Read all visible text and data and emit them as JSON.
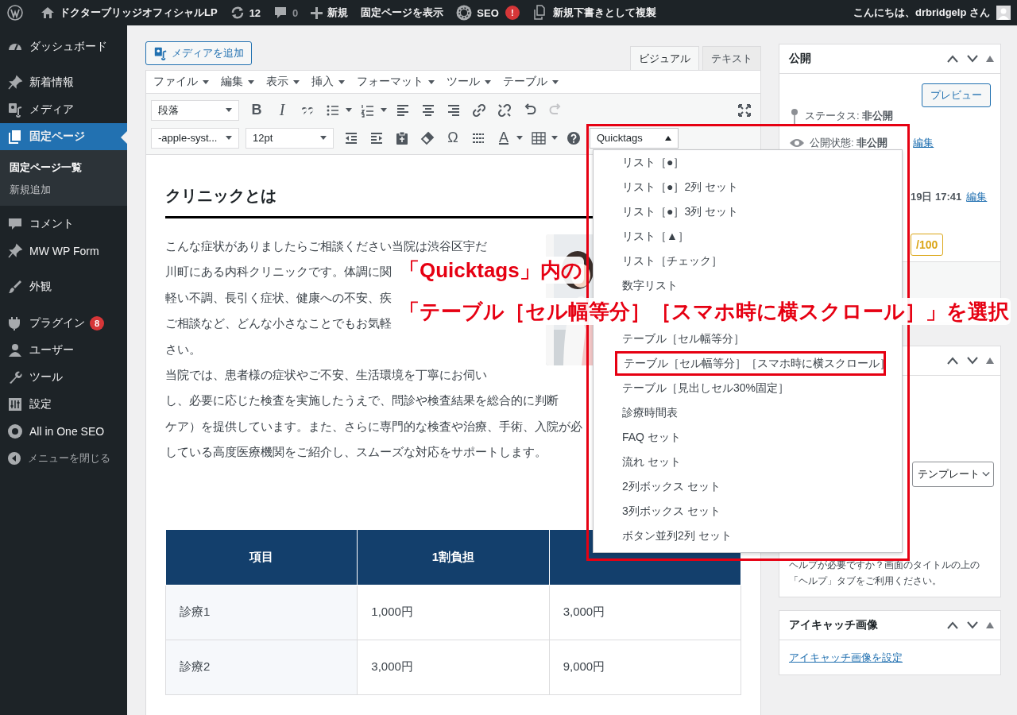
{
  "admin_bar": {
    "site_name": "ドクターブリッジオフィシャルLP",
    "updates": "12",
    "comments": "0",
    "new": "新規",
    "view_page": "固定ページを表示",
    "seo": "SEO",
    "seo_badge": "!",
    "duplicate": "新規下書きとして複製",
    "greeting": "こんにちは、drbridgelp さん"
  },
  "sidebar": {
    "items": [
      {
        "label": "ダッシュボード",
        "selected": false
      },
      {
        "label": "新着情報",
        "selected": false
      },
      {
        "label": "メディア",
        "selected": false
      },
      {
        "label": "固定ページ",
        "selected": true,
        "children": [
          {
            "label": "固定ページ一覧",
            "selected": true
          },
          {
            "label": "新規追加",
            "selected": false
          }
        ]
      },
      {
        "label": "コメント",
        "selected": false
      },
      {
        "label": "MW WP Form",
        "selected": false
      },
      {
        "label": "外観",
        "selected": false
      },
      {
        "label": "プラグイン",
        "selected": false,
        "badge": "8"
      },
      {
        "label": "ユーザー",
        "selected": false
      },
      {
        "label": "ツール",
        "selected": false
      },
      {
        "label": "設定",
        "selected": false
      },
      {
        "label": "All in One SEO",
        "selected": false
      }
    ],
    "collapse": "メニューを閉じる"
  },
  "editor": {
    "add_media": "メディアを追加",
    "tabs": [
      {
        "label": "ビジュアル",
        "selected": true
      },
      {
        "label": "テキスト",
        "selected": false
      }
    ],
    "menu": [
      "ファイル",
      "編集",
      "表示",
      "挿入",
      "フォーマット",
      "ツール",
      "テーブル"
    ],
    "toolbar": {
      "format_select": "段落",
      "bold": "B",
      "italic": "I",
      "redo_disabled": true,
      "font_select": "-apple-syst...",
      "size_select": "12pt",
      "special_char": "Ω",
      "text_color": "A",
      "quicktags_select": "Quicktags"
    },
    "heading": "クリニックとは",
    "paragraph_lines": [
      "こんな症状がありましたらご相談ください当院は渋谷区宇だ",
      "川町にある内科クリニックです。体調に関",
      "軽い不調、長引く症状、健康への不安、疾",
      "ご相談など、どんな小さなことでもお気軽",
      "さい。",
      "当院では、患者様の症状やご不安、生活環境を丁寧にお伺い",
      "し、必要に応じた検査を実施したうえで、問診や検査結果を総合的に判断",
      "ケア）を提供しています。また、さらに専門的な検査や治療、手術、入院が必",
      "している高度医療機関をご紹介し、スムーズな対応をサポートします。"
    ],
    "table": {
      "columns": [
        "項目",
        "1割負担"
      ],
      "rows": [
        [
          "診療1",
          "1,000円",
          "3,000円"
        ],
        [
          "診療2",
          "3,000円",
          "9,000円"
        ]
      ]
    }
  },
  "quicktags_menu": {
    "items": [
      {
        "label": "リスト［●］",
        "selected": false
      },
      {
        "label": "リスト［●］2列 セット",
        "selected": false
      },
      {
        "label": "リスト［●］3列 セット",
        "selected": false
      },
      {
        "label": "リスト［▲］",
        "selected": false
      },
      {
        "label": "リスト［チェック］",
        "selected": false
      },
      {
        "label": "数字リスト",
        "selected": false
      },
      {
        "label": "テーブル［セル幅等分］",
        "selected": false
      },
      {
        "label": "テーブル［セル幅等分］［スマホ時に横スクロール］",
        "selected": true
      },
      {
        "label": "テーブル［見出しセル30%固定］",
        "selected": false
      },
      {
        "label": "診療時間表",
        "selected": false
      },
      {
        "label": "FAQ セット",
        "selected": false
      },
      {
        "label": "流れ セット",
        "selected": false
      },
      {
        "label": "2列ボックス セット",
        "selected": false
      },
      {
        "label": "3列ボックス セット",
        "selected": false
      },
      {
        "label": "ボタン並列2列 セット",
        "selected": false
      }
    ]
  },
  "publish_box": {
    "title": "公開",
    "preview": "プレビュー",
    "status": "ステータス: **非公開**",
    "visibility": "公開状態: **非公開**",
    "visibility_edit": "編集",
    "time": "19日 17:41",
    "time_edit": "編集",
    "score": "/100"
  },
  "attributes_box": {
    "template_select": "テンプレート",
    "help": "ヘルプが必要ですか？画面のタイトルの上の「ヘルプ」タブをご利用ください。"
  },
  "featured_image_box": {
    "title": "アイキャッチ画像",
    "link": "アイキャッチ画像を設定"
  },
  "annotation": {
    "lines": [
      "「Quicktags」内の",
      "「テーブル［セル幅等分］［スマホ時に横スクロール］」を選択"
    ]
  }
}
